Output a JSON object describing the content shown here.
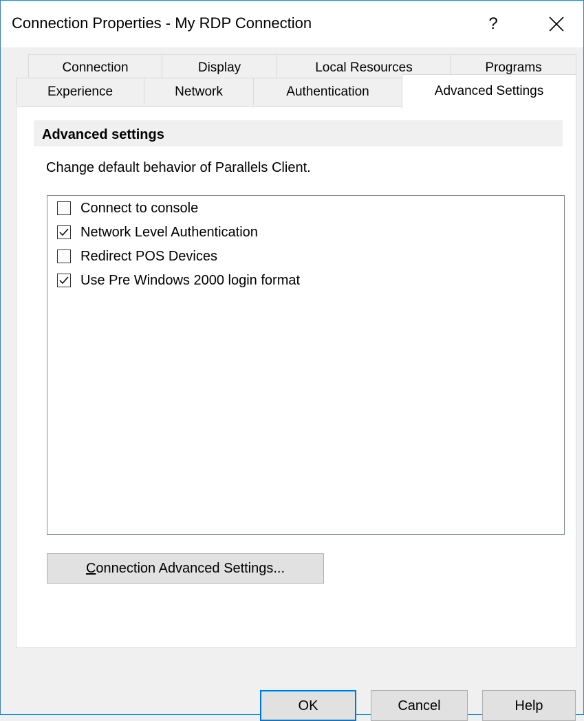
{
  "window": {
    "title": "Connection Properties - My RDP Connection",
    "help_label": "?",
    "close_icon": "close-icon"
  },
  "tabs": {
    "row1": [
      "Connection",
      "Display",
      "Local Resources",
      "Programs"
    ],
    "row2": [
      "Experience",
      "Network",
      "Authentication",
      "Advanced Settings"
    ],
    "active": "Advanced Settings"
  },
  "panel": {
    "section_title": "Advanced settings",
    "description": "Change default behavior of Parallels Client.",
    "options": [
      {
        "label": "Connect to console",
        "checked": false
      },
      {
        "label": "Network Level Authentication",
        "checked": true
      },
      {
        "label": "Redirect POS Devices",
        "checked": false
      },
      {
        "label": "Use Pre Windows 2000 login format",
        "checked": true
      }
    ],
    "advanced_button": {
      "mnemonic": "C",
      "rest": "onnection Advanced Settings..."
    }
  },
  "footer": {
    "ok": "OK",
    "cancel": "Cancel",
    "help": "Help"
  },
  "colors": {
    "accent": "#0078d7",
    "window_border": "#3c7fb1",
    "dialog_bg": "#f0f0f0"
  }
}
